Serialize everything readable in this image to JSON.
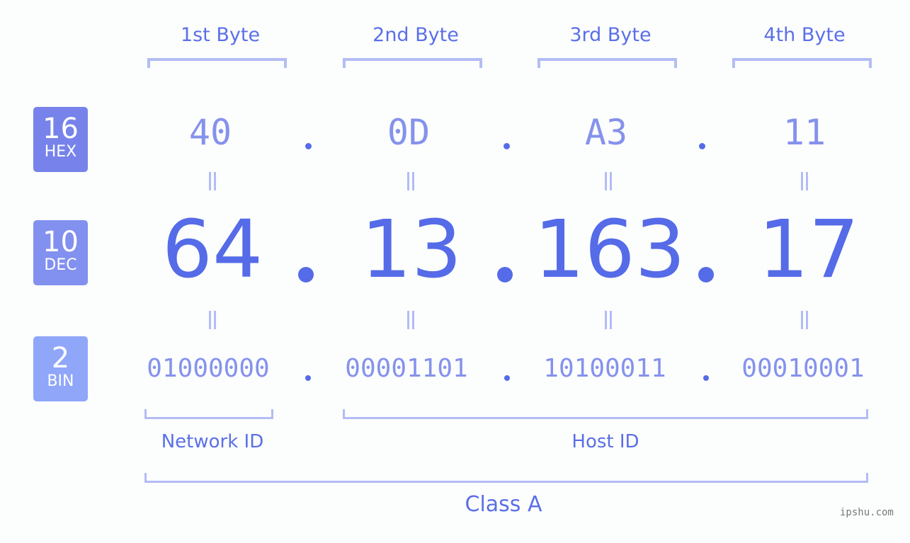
{
  "ip": {
    "bytes": [
      {
        "title": "1st Byte",
        "hex": "40",
        "dec": "64",
        "bin": "01000000"
      },
      {
        "title": "2nd Byte",
        "hex": "0D",
        "dec": "13",
        "bin": "00001101"
      },
      {
        "title": "3rd Byte",
        "hex": "A3",
        "dec": "163",
        "bin": "10100011"
      },
      {
        "title": "4th Byte",
        "hex": "11",
        "dec": "17",
        "bin": "00010001"
      }
    ],
    "equals_symbol": "="
  },
  "badges": {
    "hex": {
      "num": "16",
      "label": "HEX",
      "color": "#7783ea"
    },
    "dec": {
      "num": "10",
      "label": "DEC",
      "color": "#8290ef"
    },
    "bin": {
      "num": "2",
      "label": "BIN",
      "color": "#8fa6f9"
    }
  },
  "labels": {
    "network_id": "Network ID",
    "host_id": "Host ID",
    "class": "Class A"
  },
  "watermark": "ipshu.com",
  "colors": {
    "accent": "#556be8",
    "light": "#8592ec",
    "bracket": "#b3bcf5"
  }
}
